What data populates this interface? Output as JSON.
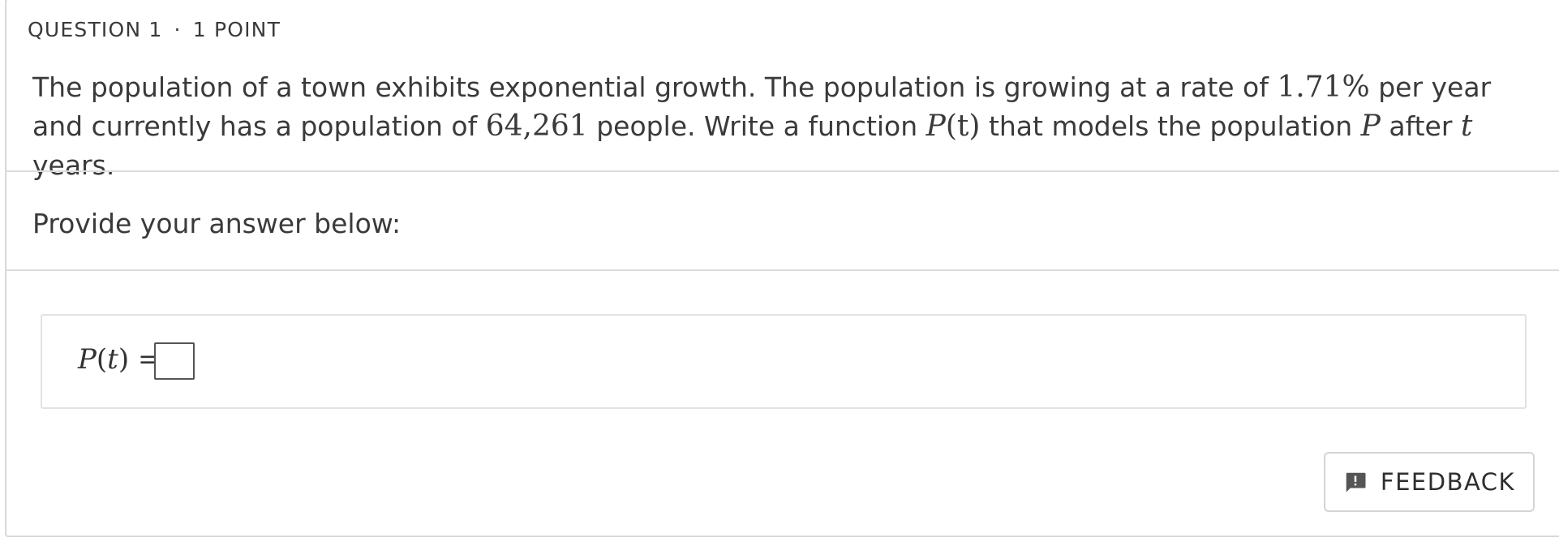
{
  "question": {
    "header": {
      "number_label": "QUESTION 1",
      "separator": "·",
      "points_label": "1 POINT"
    },
    "text": {
      "part1": "The population of a town exhibits exponential growth. The population is growing at a rate of ",
      "rate": "1.71%",
      "part2": " per year and currently has a population of ",
      "population": "64,261",
      "part3": " people. Write a function ",
      "function_name": "P",
      "function_arg": "(t)",
      "part4": " that models the population ",
      "var_p": "P",
      "part5": " after ",
      "var_t": "t",
      "part6": " years."
    }
  },
  "answer_section": {
    "prompt": "Provide your answer below:",
    "label_func": "P",
    "label_paren_open": "(",
    "label_var": "t",
    "label_paren_close": ")",
    "label_equals": " =",
    "input_value": ""
  },
  "feedback": {
    "label": "FEEDBACK",
    "icon": "feedback-icon"
  },
  "colors": {
    "text": "#3a3a3a",
    "border": "#d9d9d9",
    "icon": "#555555"
  }
}
